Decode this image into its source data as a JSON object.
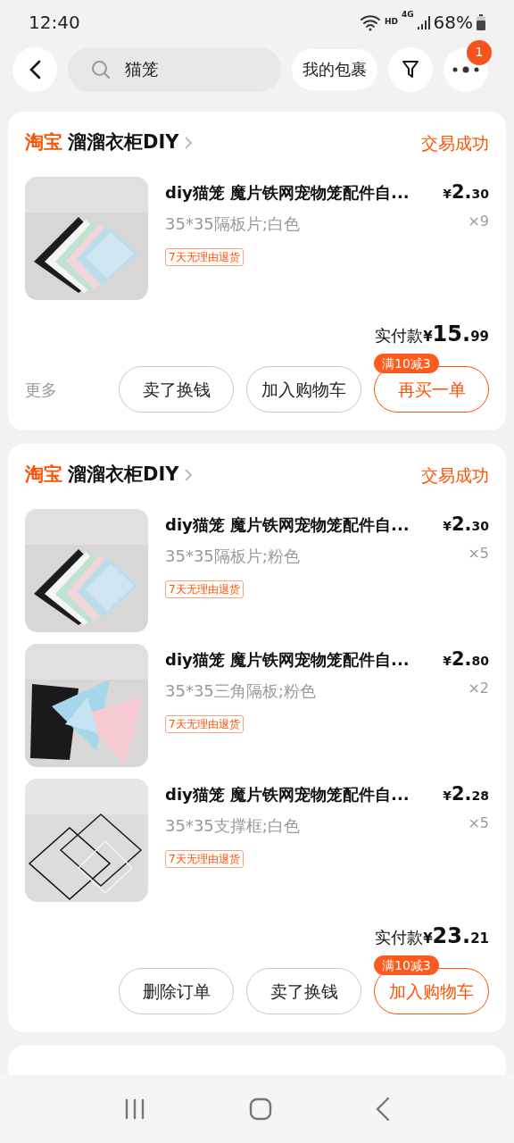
{
  "status_bar": {
    "time": "12:40",
    "network": "HD",
    "signal_label": "4G",
    "battery": "68%"
  },
  "top_bar": {
    "search": {
      "value": "猫笼"
    },
    "package_button": "我的包裹",
    "notification_count": "1"
  },
  "orders": [
    {
      "platform": "淘宝",
      "shop": "溜溜衣柜DIY",
      "status": "交易成功",
      "items": [
        {
          "title": "diy猫笼 魔片铁网宠物笼配件自...",
          "spec": "35*35隔板片;白色",
          "tag": "7天无理由退货",
          "price": "¥2.30",
          "quantity": "×9"
        }
      ],
      "total_label": "实付款",
      "total": "¥15.99",
      "more": "更多",
      "buttons": [
        {
          "label": "卖了换钱",
          "kind": "plain"
        },
        {
          "label": "加入购物车",
          "kind": "plain"
        },
        {
          "label": "再买一单",
          "kind": "primary",
          "badge": "满10减3"
        }
      ]
    },
    {
      "platform": "淘宝",
      "shop": "溜溜衣柜DIY",
      "status": "交易成功",
      "items": [
        {
          "title": "diy猫笼 魔片铁网宠物笼配件自...",
          "spec": "35*35隔板片;粉色",
          "tag": "7天无理由退货",
          "price": "¥2.30",
          "quantity": "×5"
        },
        {
          "title": "diy猫笼 魔片铁网宠物笼配件自...",
          "spec": "35*35三角隔板;粉色",
          "tag": "7天无理由退货",
          "price": "¥2.80",
          "quantity": "×2"
        },
        {
          "title": "diy猫笼 魔片铁网宠物笼配件自...",
          "spec": "35*35支撑框;白色",
          "tag": "7天无理由退货",
          "price": "¥2.28",
          "quantity": "×5"
        }
      ],
      "total_label": "实付款",
      "total": "¥23.21",
      "buttons": [
        {
          "label": "删除订单",
          "kind": "plain"
        },
        {
          "label": "卖了换钱",
          "kind": "plain"
        },
        {
          "label": "加入购物车",
          "kind": "primary",
          "badge": "满10减3"
        }
      ]
    }
  ]
}
